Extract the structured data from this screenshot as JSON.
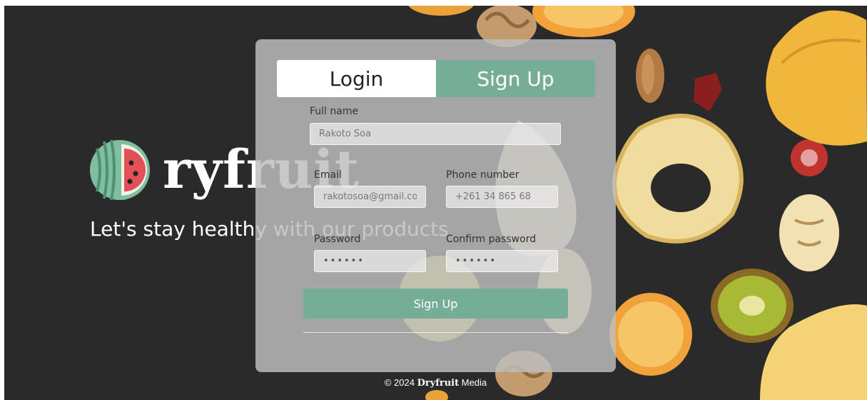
{
  "brand": {
    "name": "ryfruit",
    "tagline": "Let's stay healthy with our products"
  },
  "tabs": {
    "login": "Login",
    "signup": "Sign Up"
  },
  "form": {
    "full_name": {
      "label": "Full name",
      "value": "Rakoto Soa"
    },
    "email": {
      "label": "Email",
      "value": "rakotosoa@gmail.co"
    },
    "phone": {
      "label": "Phone number",
      "value": "+261 34 865 68"
    },
    "password": {
      "label": "Password",
      "value": "••••••"
    },
    "confirm_password": {
      "label": "Confirm password",
      "value": "••••••"
    },
    "submit": "Sign Up"
  },
  "footer": {
    "prefix": "© 2024",
    "brand": "Dryfruit",
    "suffix": "Media"
  },
  "colors": {
    "accent": "#75ad97",
    "background": "#2a2a2a",
    "watermelon_rind": "#7fbf9f",
    "watermelon_flesh": "#e2515a"
  },
  "icons": {
    "logo": "watermelon-d-logo"
  }
}
